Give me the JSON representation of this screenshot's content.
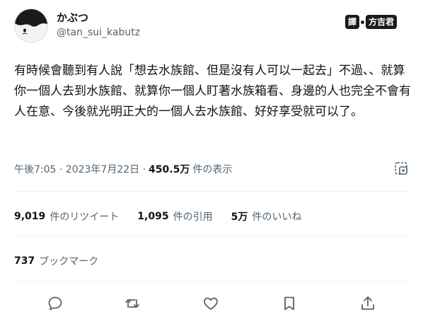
{
  "author": {
    "display_name": "かぶつ",
    "handle": "@tan_sui_kabutz"
  },
  "translator_badge": {
    "left": "譯",
    "right": "方吉君"
  },
  "tweet": {
    "text": "有時候會聽到有人說「想去水族館、但是沒有人可以一起去」不過、、就算你一個人去到水族館、就算你一個人盯著水族箱看、身邊的人也完全不會有人在意、今後就光明正大的一個人去水族館、好好享受就可以了。"
  },
  "meta": {
    "timestamp": "午後7:05 · 2023年7月22日 ·",
    "views_count": "450.5万",
    "views_label": "件の表示"
  },
  "stats": {
    "retweets_count": "9,019",
    "retweets_label": "件のリツイート",
    "quotes_count": "1,095",
    "quotes_label": "件の引用",
    "likes_count": "5万",
    "likes_label": "件のいいね",
    "bookmarks_count": "737",
    "bookmarks_label": "ブックマーク"
  },
  "icons": {
    "grok": "grok-icon",
    "reply": "reply-icon",
    "retweet": "retweet-icon",
    "like": "heart-icon",
    "bookmark": "bookmark-icon",
    "share": "share-icon"
  },
  "colors": {
    "text_primary": "#0f1419",
    "text_secondary": "#536471",
    "divider": "#eff3f4"
  }
}
